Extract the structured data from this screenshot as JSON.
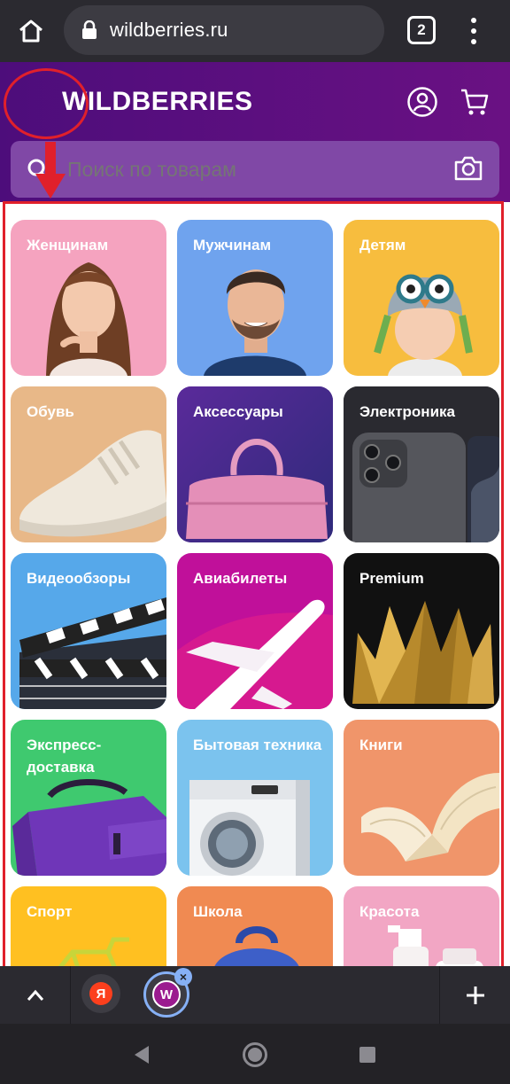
{
  "browser": {
    "url": "wildberries.ru",
    "tab_count": "2"
  },
  "header": {
    "logo": "WILDBERRIES",
    "search_placeholder": "Поиск по товарам"
  },
  "categories": [
    {
      "label": "Женщинам",
      "icon": "woman-portrait",
      "color": "#f5a3bf"
    },
    {
      "label": "Мужчинам",
      "icon": "man-portrait",
      "color": "#6fa3ee"
    },
    {
      "label": "Детям",
      "icon": "baby-in-knit-hat",
      "color": "#f7bd3e"
    },
    {
      "label": "Обувь",
      "icon": "sneaker",
      "color": "#e8b888"
    },
    {
      "label": "Аксессуары",
      "icon": "handbag",
      "color": "#6c2d9a"
    },
    {
      "label": "Электроника",
      "icon": "smartphone",
      "color": "#2d2d33"
    },
    {
      "label": "Видеообзоры",
      "icon": "clapperboard",
      "color": "#56a8ea"
    },
    {
      "label": "Авиабилеты",
      "icon": "airplane",
      "color": "#c0109a"
    },
    {
      "label": "Premium",
      "icon": "gold-crown",
      "color": "#111111"
    },
    {
      "label": "Экспресс-доставка",
      "icon": "delivery-bag",
      "color": "#3fc96f"
    },
    {
      "label": "Бытовая техника",
      "icon": "washing-machine",
      "color": "#7bc3ee"
    },
    {
      "label": "Книги",
      "icon": "open-book",
      "color": "#f0956a"
    },
    {
      "label": "Спорт",
      "icon": "bicycle",
      "color": "#ffc021"
    },
    {
      "label": "Школа",
      "icon": "backpack",
      "color": "#f08a52"
    },
    {
      "label": "Красота",
      "icon": "cosmetics",
      "color": "#f2a6c4"
    }
  ],
  "tab_strip": {
    "tab1_icon": "Я",
    "tab2_icon": "W"
  },
  "colors": {
    "brand_purple": "#5b0f80",
    "annotation_red": "#e0202b"
  }
}
